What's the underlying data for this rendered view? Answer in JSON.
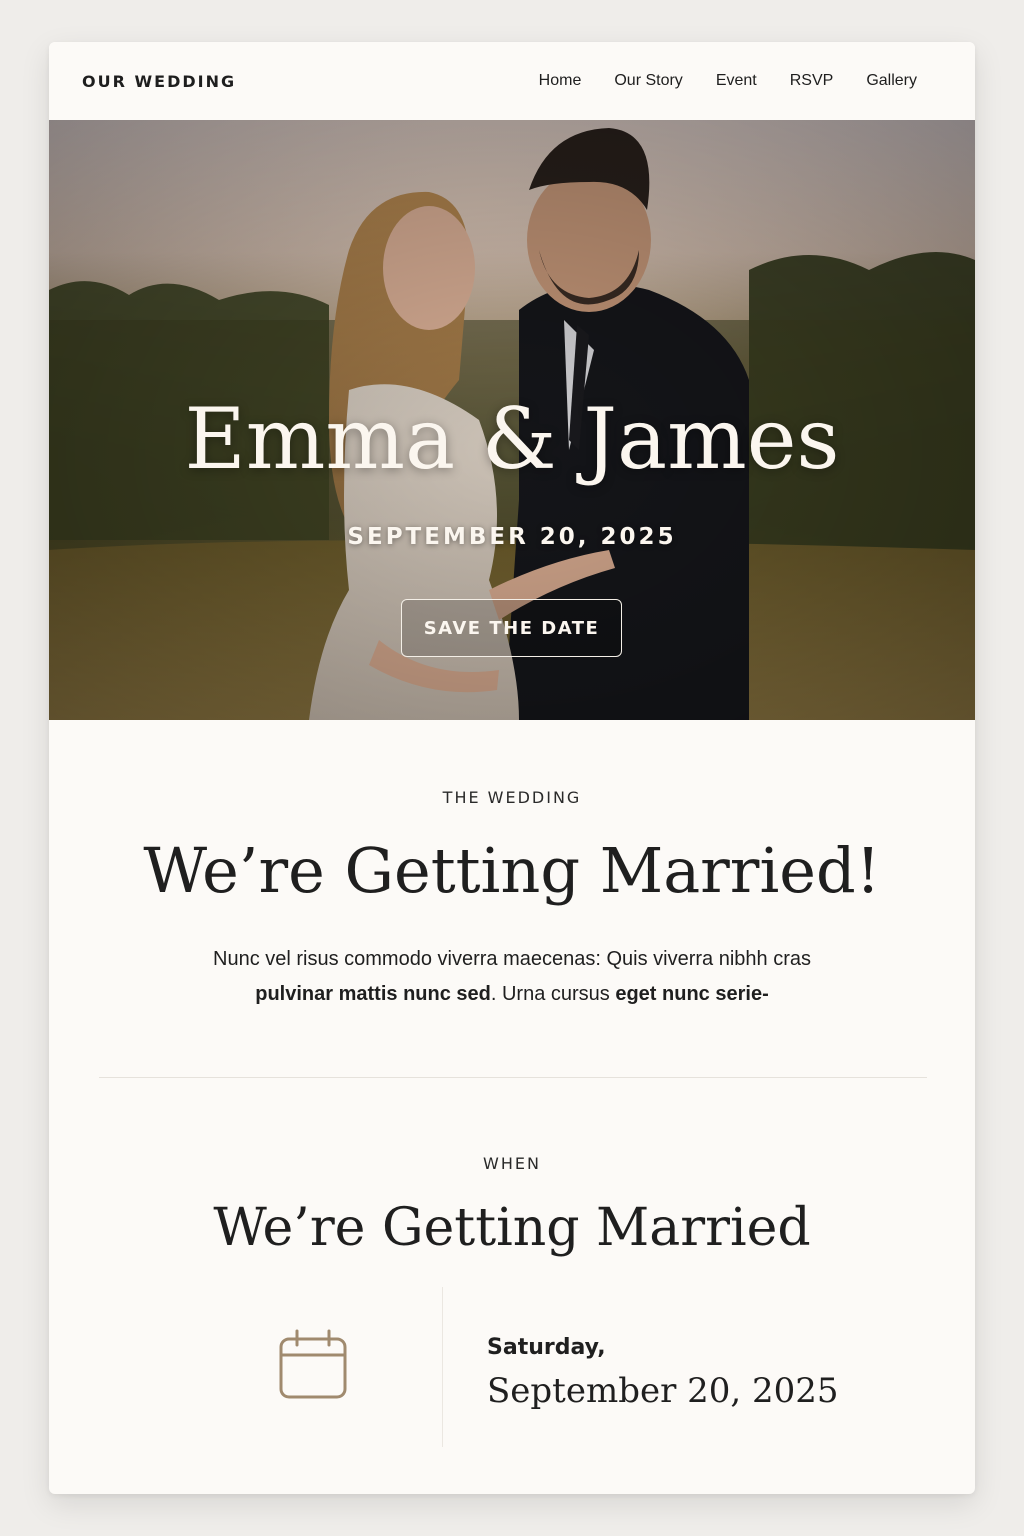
{
  "header": {
    "brand": "OUR WEDDING",
    "nav": [
      "Home",
      "Our Story",
      "Event",
      "RSVP",
      "Gallery"
    ]
  },
  "hero": {
    "names": "Emma & James",
    "date": "SEPTEMBER 20, 2025",
    "cta_label": "SAVE THE DATE"
  },
  "intro": {
    "eyebrow": "THE WEDDING",
    "title": "We’re Getting Married!",
    "text_1": "Nunc vel risus commodo viverra maecenas: Quis viverra nibhh cras",
    "text_2_bold_a": "pulvinar mattis nunc sed",
    "text_2_mid": ". Urna cursus ",
    "text_2_bold_b": "eget nunc serie-"
  },
  "when": {
    "eyebrow": "WHEN",
    "title": "We’re Getting Married",
    "day": "Saturday,",
    "date": "September 20, 2025",
    "icon": "calendar-icon"
  },
  "colors": {
    "background": "#efedea",
    "card": "#fcfaf7",
    "text": "#1f1f1f",
    "accent_icon": "#a08a6e",
    "hero_text": "#fbf6ef"
  }
}
